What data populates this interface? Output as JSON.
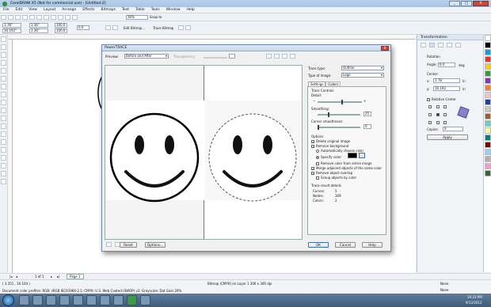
{
  "app": {
    "title": "CorelDRAW X5 (Not for commercial use) - [Untitled-2]",
    "window_buttons": {
      "minimize": "_",
      "maximize": "□",
      "close": "X"
    }
  },
  "menu": [
    "File",
    "Edit",
    "View",
    "Layout",
    "Arrange",
    "Effects",
    "Bitmaps",
    "Text",
    "Table",
    "Tools",
    "Window",
    "Help"
  ],
  "toolbar": {
    "zoom": "30%",
    "snap_to": "Snap to",
    "x_field": "1.78\"",
    "y_field": "16.192\"",
    "w_field": "3.36\"",
    "h_field": "3.36\"",
    "scale_x": "100.0",
    "scale_y": "100.0",
    "angle": "0.0",
    "edit_bitmap": "Edit Bitmap...",
    "trace_bitmap": "Trace Bitmap"
  },
  "dialog": {
    "title": "PowerTRACE",
    "close": "X",
    "preview_label": "Preview:",
    "preview_value": "Before and After",
    "transparency_label": "Transparency:",
    "trace_type_label": "Trace type:",
    "trace_type_value": "Outline",
    "image_type_label": "Type of image:",
    "image_type_value": "Logo",
    "tabs": [
      "Settings",
      "Colors"
    ],
    "trace_controls": "Trace Controls",
    "detail_label": "Detail:",
    "detail_level": 0.55,
    "smoothing_label": "Smoothing:",
    "smoothing_value": "25",
    "smoothing_level": 0.25,
    "corner_label": "Corner smoothness:",
    "corner_value": "0",
    "corner_level": 0.0,
    "options_label": "Options",
    "opt_delete": "Delete original image",
    "opt_remove_bg": "Remove background",
    "opt_auto_color": "Automatically choose color",
    "opt_specify_color": "Specify color:",
    "opt_remove_entire": "Remove color from entire image",
    "opt_merge": "Merge adjacent objects of the same color",
    "opt_remove_overlap": "Remove object overlap",
    "opt_group": "Group objects by color",
    "results_label": "Trace result details",
    "curves_label": "Curves:",
    "curves_value": "5",
    "nodes_label": "Nodes:",
    "nodes_value": "309",
    "colors_label": "Colors:",
    "colors_value": "2",
    "reset": "Reset",
    "options": "Options...",
    "ok": "OK",
    "cancel": "Cancel",
    "help": "Help",
    "specify_color_swatch": "#000000"
  },
  "docker": {
    "title": "Transformation",
    "rotation_label": "Rotation",
    "angle_label": "Angle:",
    "angle_value": "0.0",
    "angle_unit": "deg",
    "center_label": "Center:",
    "x_label": "x:",
    "x_value": "1.78",
    "y_label": "y:",
    "y_value": "16.192",
    "x_unit": "in",
    "y_unit": "in",
    "relative_center": "Relative Center",
    "copies_label": "Copies:",
    "copies_value": "0",
    "apply": "Apply"
  },
  "palette_colors": [
    "#ffffff",
    "#000000",
    "#00a2e8",
    "#ff2828",
    "#ffd000",
    "#2ea043",
    "#7d3cb5",
    "#ff7f27",
    "#f2c4cf",
    "#1e3f9a",
    "#c8c8c8",
    "#a05a2c",
    "#66cccc",
    "#ffff99",
    "#008080",
    "#800000",
    "#99ccff",
    "#b0b0b0",
    "#ff99cc",
    "#336633"
  ],
  "pagebar": {
    "page_count": "1 of 1",
    "page_tab": "Page 1"
  },
  "status": {
    "coords": "( 3.351 , 16.104 )",
    "object_info": "Bitmap (CMYK) on Layer 1 300 x 300 dpi",
    "profile_line": "Document color profiles: RGB: sRGB IEC61966-2.1; CMYK: U.S. Web Coated (SWOP) v2; Grayscale: Dot Gain 20%",
    "fill_none": "None",
    "outline_none": "None"
  },
  "taskbar": {
    "time": "10:23 PM",
    "date": "9/12/2012"
  }
}
